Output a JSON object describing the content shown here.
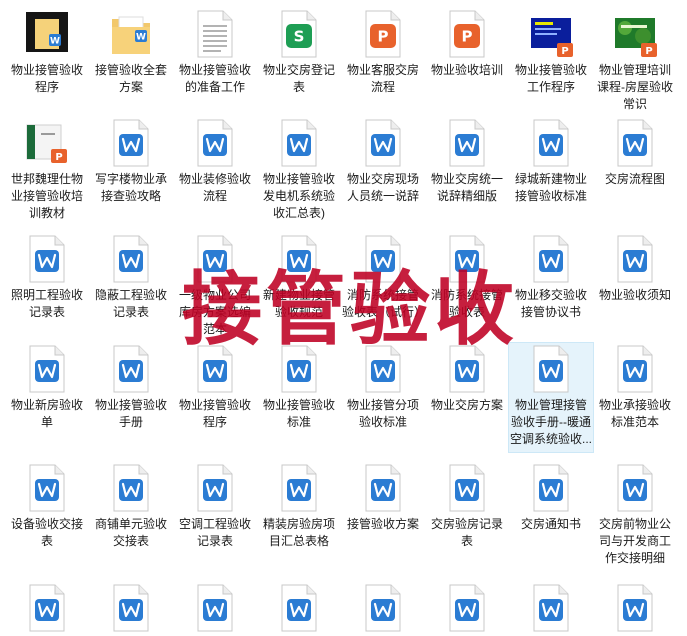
{
  "files": [
    {
      "label": "物业接管验收程序",
      "icon": "dark-thumbnail-doc-icon"
    },
    {
      "label": "接管验收全套方案",
      "icon": "folder-icon"
    },
    {
      "label": "物业接管验收的准备工作",
      "icon": "text-file-icon"
    },
    {
      "label": "物业交房登记表",
      "icon": "spreadsheet-file-icon"
    },
    {
      "label": "物业客服交房流程",
      "icon": "ppt-file-icon"
    },
    {
      "label": "物业验收培训",
      "icon": "ppt-file-icon"
    },
    {
      "label": "物业接管验收工作程序",
      "icon": "blue-slide-ppt-icon"
    },
    {
      "label": "物业管理培训课程-房屋验收常识",
      "icon": "green-slide-ppt-icon"
    },
    {
      "label": "世邦魏理仕物业接管验收培训教材",
      "icon": "book-ppt-icon"
    },
    {
      "label": "写字楼物业承接查验攻略",
      "icon": "word-file-icon"
    },
    {
      "label": "物业装修验收流程",
      "icon": "word-file-icon"
    },
    {
      "label": "物业接管验收发电机系统验收汇总表)",
      "icon": "word-file-icon"
    },
    {
      "label": "物业交房现场人员统一说辞",
      "icon": "word-file-icon"
    },
    {
      "label": "物业交房统一说辞精细版",
      "icon": "word-file-icon"
    },
    {
      "label": "绿城新建物业接管验收标准",
      "icon": "word-file-icon"
    },
    {
      "label": "交房流程图",
      "icon": "word-file-icon"
    },
    {
      "label": "照明工程验收记录表",
      "icon": "word-file-icon"
    },
    {
      "label": "隐蔽工程验收记录表",
      "icon": "word-file-icon"
    },
    {
      "label": "一级物业公司库房方案选编范本",
      "icon": "word-file-icon"
    },
    {
      "label": "新建物业接管验收规范",
      "icon": "word-file-icon"
    },
    {
      "label": "消防系统接管验收表（试行）",
      "icon": "word-file-icon"
    },
    {
      "label": "消防系统接管验收表",
      "icon": "word-file-icon"
    },
    {
      "label": "物业移交验收接管协议书",
      "icon": "word-file-icon"
    },
    {
      "label": "物业验收须知",
      "icon": "word-file-icon"
    },
    {
      "label": "物业新房验收单",
      "icon": "word-file-icon"
    },
    {
      "label": "物业接管验收手册",
      "icon": "word-file-icon"
    },
    {
      "label": "物业接管验收程序",
      "icon": "word-file-icon"
    },
    {
      "label": "物业接管验收标准",
      "icon": "word-file-icon"
    },
    {
      "label": "物业接管分项验收标准",
      "icon": "word-file-icon"
    },
    {
      "label": "物业交房方案",
      "icon": "word-file-icon"
    },
    {
      "label": "物业管理接管验收手册--暖通空调系统验收...",
      "icon": "word-file-icon"
    },
    {
      "label": "物业承接验收标准范本",
      "icon": "word-file-icon"
    },
    {
      "label": "设备验收交接表",
      "icon": "word-file-icon"
    },
    {
      "label": "商铺单元验收交接表",
      "icon": "word-file-icon"
    },
    {
      "label": "空调工程验收记录表",
      "icon": "word-file-icon"
    },
    {
      "label": "精装房验房项目汇总表格",
      "icon": "word-file-icon"
    },
    {
      "label": "接管验收方案",
      "icon": "word-file-icon"
    },
    {
      "label": "交房验房记录表",
      "icon": "word-file-icon"
    },
    {
      "label": "交房通知书",
      "icon": "word-file-icon"
    },
    {
      "label": "交房前物业公司与开发商工作交接明细",
      "icon": "word-file-icon"
    },
    {
      "label": "",
      "icon": "word-file-icon"
    },
    {
      "label": "",
      "icon": "word-file-icon"
    },
    {
      "label": "",
      "icon": "word-file-icon"
    },
    {
      "label": "",
      "icon": "word-file-icon"
    },
    {
      "label": "",
      "icon": "word-file-icon"
    },
    {
      "label": "",
      "icon": "word-file-icon"
    },
    {
      "label": "",
      "icon": "word-file-icon"
    },
    {
      "label": "",
      "icon": "word-file-icon"
    }
  ],
  "selected_index": 30,
  "watermark": "接管验收",
  "colors": {
    "watermark": "#be0023",
    "word_blue": "#2b7cd3",
    "ppt_orange": "#e8622c",
    "sheet_green": "#1e9e54",
    "folder_yellow": "#f2c86b",
    "selection_bg": "#e5f3fb"
  }
}
